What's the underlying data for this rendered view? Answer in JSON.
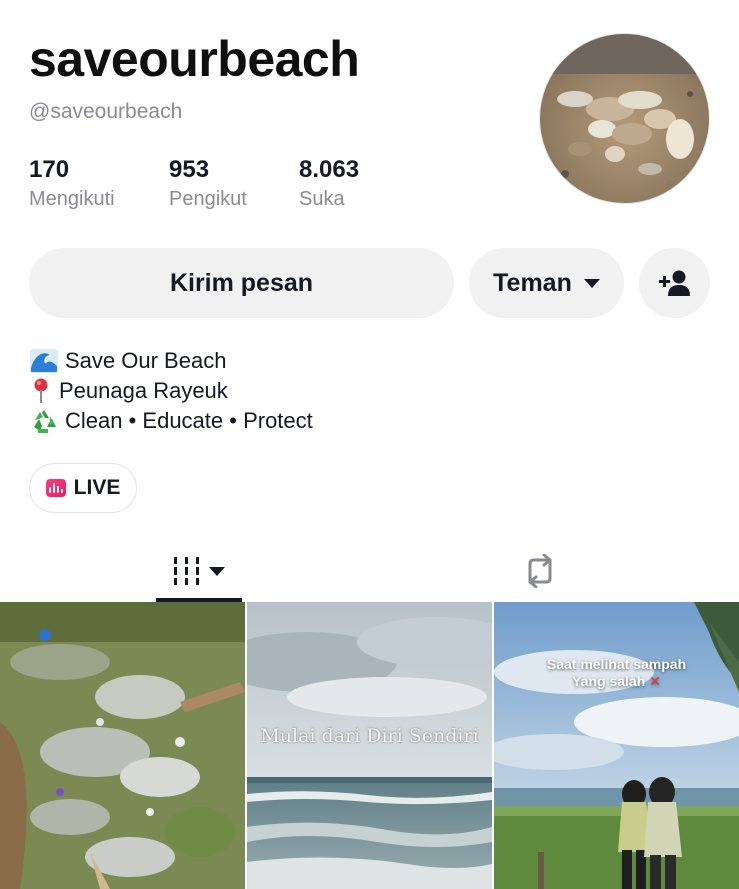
{
  "profile": {
    "username": "saveourbeach",
    "handle": "@saveourbeach"
  },
  "stats": [
    {
      "value": "170",
      "label": "Mengikuti"
    },
    {
      "value": "953",
      "label": "Pengikut"
    },
    {
      "value": "8.063",
      "label": "Suka"
    }
  ],
  "actions": {
    "message_label": "Kirim pesan",
    "friend_label": "Teman"
  },
  "bio": {
    "line1_emoji": "🌊",
    "line1": "Save Our Beach",
    "line2_emoji": "📍",
    "line2": "Peunaga Rayeuk",
    "line3_emoji": "♻️",
    "line3": "Clean • Educate • Protect"
  },
  "live": {
    "label": "LIVE"
  },
  "videos": [
    {
      "overlay": ""
    },
    {
      "overlay": "Mulai dari Diri Sendiri"
    },
    {
      "overlay_line1": "Saat melihat sampah",
      "overlay_line2": "Yang salah",
      "overlay_mark": "✕"
    }
  ],
  "icons": {
    "grid_tab": "grid-icon",
    "repost_tab": "repost-icon",
    "add_friend": "person-add-icon",
    "dropdown": "caret-down-icon"
  },
  "colors": {
    "text": "#161823",
    "muted": "#8a8b91",
    "button_bg": "#f1f1f2",
    "live_accent": "#ff3b7f"
  }
}
